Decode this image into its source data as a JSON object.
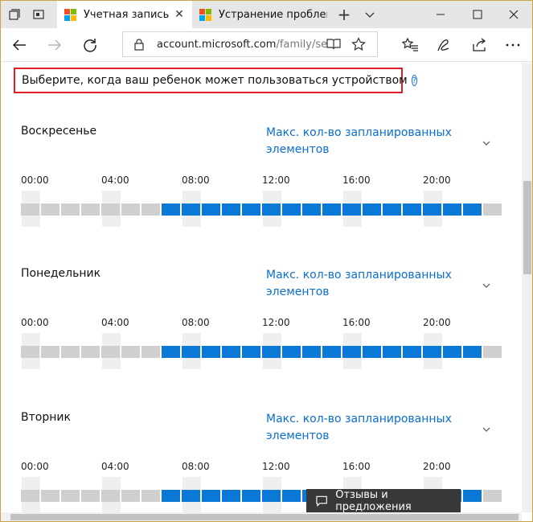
{
  "browser": {
    "tabs": [
      {
        "title": "Учетная запись Ma",
        "active": true
      },
      {
        "title": "Устранение проблемь",
        "active": false
      }
    ],
    "new_tab_symbol": "+",
    "url_host": "account.microsoft.com",
    "url_path": "/family/set"
  },
  "page": {
    "headline": "Выберите, когда ваш ребенок может пользоваться устройством",
    "help_symbol": "?",
    "max_link": "Макс. кол-во запланированных элементов",
    "hours": [
      "00:00",
      "04:00",
      "08:00",
      "12:00",
      "16:00",
      "20:00"
    ],
    "days": [
      {
        "name": "Воскресенье",
        "allowed_from_slot": 7,
        "allowed_to_slot": 22
      },
      {
        "name": "Понедельник",
        "allowed_from_slot": 7,
        "allowed_to_slot": 22
      },
      {
        "name": "Вторник",
        "allowed_from_slot": 7,
        "allowed_to_slot": 22
      }
    ],
    "slot_count": 24
  },
  "feedback": {
    "label": "Отзывы и предложения"
  },
  "colors": {
    "accent": "#0a78d7",
    "highlight_border": "#e0202b",
    "slot_off": "#cfcfcf",
    "link": "#0a6ed1"
  }
}
